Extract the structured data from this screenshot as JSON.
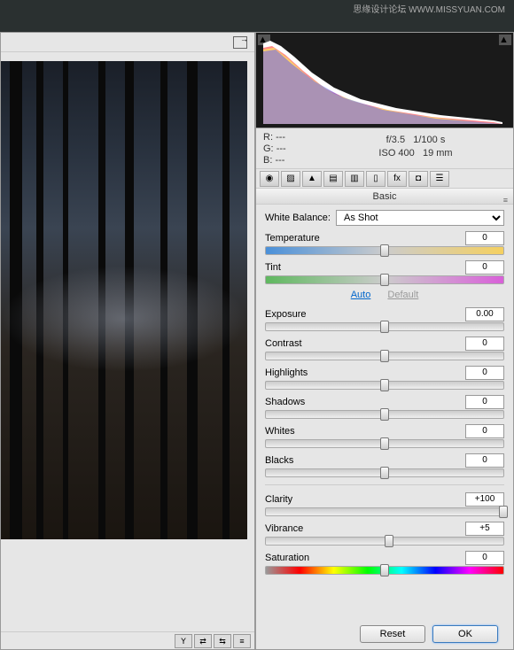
{
  "watermark": "思缘设计论坛  WWW.MISSYUAN.COM",
  "info": {
    "r_label": "R:",
    "r_val": "---",
    "g_label": "G:",
    "g_val": "---",
    "b_label": "B:",
    "b_val": "---",
    "aperture": "f/3.5",
    "shutter": "1/100 s",
    "iso": "ISO 400",
    "focal": "19 mm"
  },
  "panel_title": "Basic",
  "wb": {
    "label": "White Balance:",
    "value": "As Shot"
  },
  "links": {
    "auto": "Auto",
    "default": "Default"
  },
  "sliders": {
    "temperature": {
      "label": "Temperature",
      "value": "0",
      "pos": 50
    },
    "tint": {
      "label": "Tint",
      "value": "0",
      "pos": 50
    },
    "exposure": {
      "label": "Exposure",
      "value": "0.00",
      "pos": 50
    },
    "contrast": {
      "label": "Contrast",
      "value": "0",
      "pos": 50
    },
    "highlights": {
      "label": "Highlights",
      "value": "0",
      "pos": 50
    },
    "shadows": {
      "label": "Shadows",
      "value": "0",
      "pos": 50
    },
    "whites": {
      "label": "Whites",
      "value": "0",
      "pos": 50
    },
    "blacks": {
      "label": "Blacks",
      "value": "0",
      "pos": 50
    },
    "clarity": {
      "label": "Clarity",
      "value": "+100",
      "pos": 100
    },
    "vibrance": {
      "label": "Vibrance",
      "value": "+5",
      "pos": 52
    },
    "saturation": {
      "label": "Saturation",
      "value": "0",
      "pos": 50
    }
  },
  "buttons": {
    "reset": "Reset",
    "ok": "OK"
  }
}
